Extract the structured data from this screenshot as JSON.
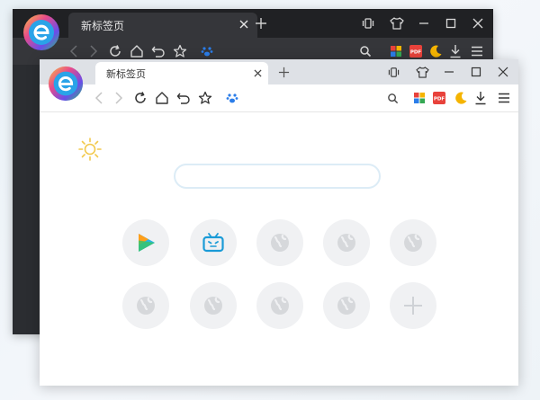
{
  "app": {
    "name": "360 Browser"
  },
  "back_window": {
    "tab": {
      "title": "新标签页"
    }
  },
  "front_window": {
    "tab": {
      "title": "新标签页"
    },
    "search": {
      "placeholder": ""
    }
  },
  "toolbar_icons": [
    "back-icon",
    "forward-icon",
    "reload-icon",
    "home-icon",
    "undo-icon",
    "star-icon",
    "paw-icon",
    "search-icon",
    "apps-icon",
    "pdf-icon",
    "moon-icon",
    "download-icon",
    "menu-icon"
  ],
  "speed_dial": [
    {
      "name": "tile-video",
      "icon": "play-icon"
    },
    {
      "name": "tile-bilibili",
      "icon": "tv-face-icon"
    },
    {
      "name": "tile-empty-3",
      "icon": "globe-icon"
    },
    {
      "name": "tile-empty-4",
      "icon": "globe-icon"
    },
    {
      "name": "tile-empty-5",
      "icon": "globe-icon"
    },
    {
      "name": "tile-empty-6",
      "icon": "globe-icon"
    },
    {
      "name": "tile-empty-7",
      "icon": "globe-icon"
    },
    {
      "name": "tile-empty-8",
      "icon": "globe-icon"
    },
    {
      "name": "tile-empty-9",
      "icon": "globe-icon"
    },
    {
      "name": "tile-add",
      "icon": "plus-icon"
    }
  ],
  "colors": {
    "dark_bg": "#2b2d31",
    "dark_titlebar": "#202124",
    "light_titlebar": "#dee1e6",
    "accent_blue": "#2b7de9",
    "pdf_red": "#e8423b",
    "moon_yellow": "#f5b400",
    "sun_yellow": "#f2c94c",
    "tile_bg": "#f0f1f3"
  }
}
